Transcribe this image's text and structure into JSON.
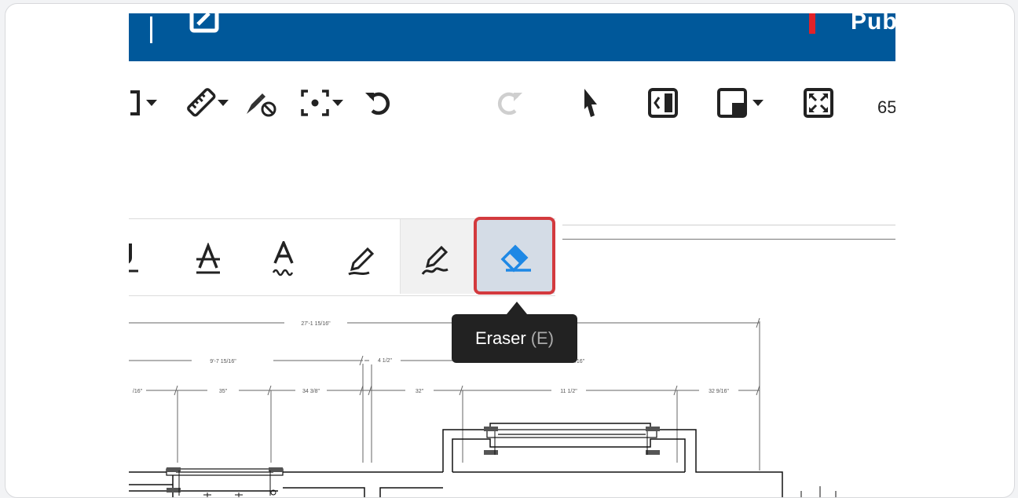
{
  "header": {
    "title_partial": "Pub"
  },
  "toolbar": {
    "zoom_partial": "65"
  },
  "markup_tools": {
    "active_tool": "eraser",
    "tooltip": {
      "label": "Eraser",
      "shortcut": "(E)"
    }
  },
  "drawing": {
    "dimensions": [
      "27'-1 15/16\"",
      "9'-7 15/16\"",
      "4 1/2\"",
      "/16\"",
      "35\"",
      "34 3/8\"",
      "32\"",
      "11 1/2\"",
      "32 9/16\"",
      "/16\""
    ]
  },
  "colors": {
    "header_bg": "#00589a",
    "highlight": "#d33a3e",
    "tooltip_bg": "#222222",
    "eraser_blue": "#1e88e5"
  }
}
